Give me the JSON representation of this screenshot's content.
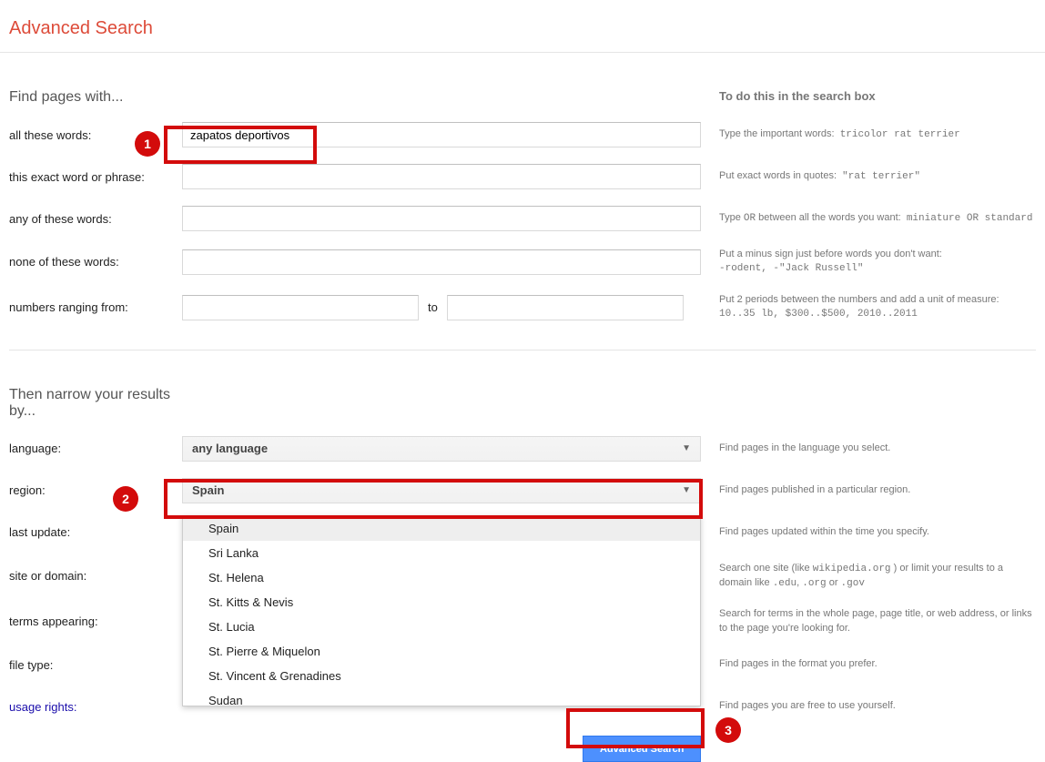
{
  "header": {
    "title": "Advanced Search"
  },
  "section1": {
    "title": "Find pages with...",
    "help_header": "To do this in the search box"
  },
  "rows1": {
    "all_words": {
      "label": "all these words:",
      "value": "zapatos deportivos",
      "help_a": "Type the important words:",
      "help_b": "tricolor rat terrier"
    },
    "exact": {
      "label": "this exact word or phrase:",
      "value": "",
      "help_a": "Put exact words in quotes:",
      "help_b": "\"rat terrier\""
    },
    "any": {
      "label": "any of these words:",
      "value": "",
      "help_a": "Type ",
      "help_or": "OR",
      "help_b": " between all the words you want:",
      "help_c": "miniature OR standard"
    },
    "none": {
      "label": "none of these words:",
      "value": "",
      "help_a": "Put a minus sign just before words you don't want:",
      "help_b": "-rodent, -\"Jack Russell\""
    },
    "range": {
      "label": "numbers ranging from:",
      "value_from": "",
      "to": "to",
      "value_to": "",
      "help_a": "Put 2 periods between the numbers and add a unit of measure:",
      "help_b": "10..35 lb, $300..$500, 2010..2011"
    }
  },
  "section2": {
    "title": "Then narrow your results by..."
  },
  "rows2": {
    "language": {
      "label": "language:",
      "value": "any language",
      "help": "Find pages in the language you select."
    },
    "region": {
      "label": "region:",
      "value": "Spain",
      "help": "Find pages published in a particular region."
    },
    "last_update": {
      "label": "last update:",
      "help": "Find pages updated within the time you specify."
    },
    "site": {
      "label": "site or domain:",
      "help_a": "Search one site (like ",
      "help_code": "wikipedia.org",
      "help_b": " ) or limit your results to a domain like ",
      "help_c": ".edu",
      "help_d": ", ",
      "help_e": ".org",
      "help_f": " or ",
      "help_g": ".gov"
    },
    "terms": {
      "label": "terms appearing:",
      "help": "Search for terms in the whole page, page title, or web address, or links to the page you're looking for."
    },
    "filetype": {
      "label": "file type:",
      "help": "Find pages in the format you prefer."
    },
    "rights": {
      "label": "usage rights:",
      "help": "Find pages you are free to use yourself."
    }
  },
  "dropdown": {
    "items": [
      "Spain",
      "Sri Lanka",
      "St. Helena",
      "St. Kitts & Nevis",
      "St. Lucia",
      "St. Pierre & Miquelon",
      "St. Vincent & Grenadines",
      "Sudan"
    ]
  },
  "submit": {
    "label": "Advanced Search"
  },
  "annotations": {
    "b1": "1",
    "b2": "2",
    "b3": "3"
  }
}
